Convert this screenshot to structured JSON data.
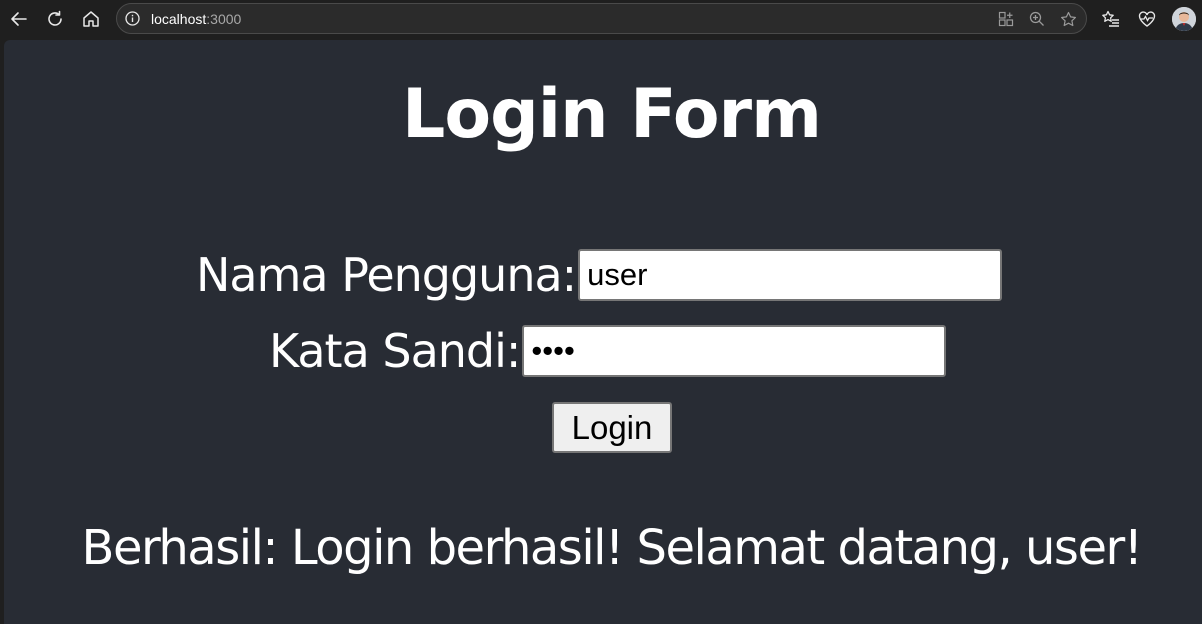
{
  "browser": {
    "url_host": "localhost",
    "url_port": ":3000"
  },
  "page": {
    "title": "Login Form",
    "username_label": "Nama Pengguna:",
    "username_value": "user",
    "password_label": "Kata Sandi:",
    "password_value": "user",
    "login_button_label": "Login",
    "status_message": "Berhasil: Login berhasil! Selamat datang, user!"
  },
  "colors": {
    "page_background": "#282c34",
    "toolbar_background": "#1f1f1f",
    "text": "#ffffff"
  }
}
